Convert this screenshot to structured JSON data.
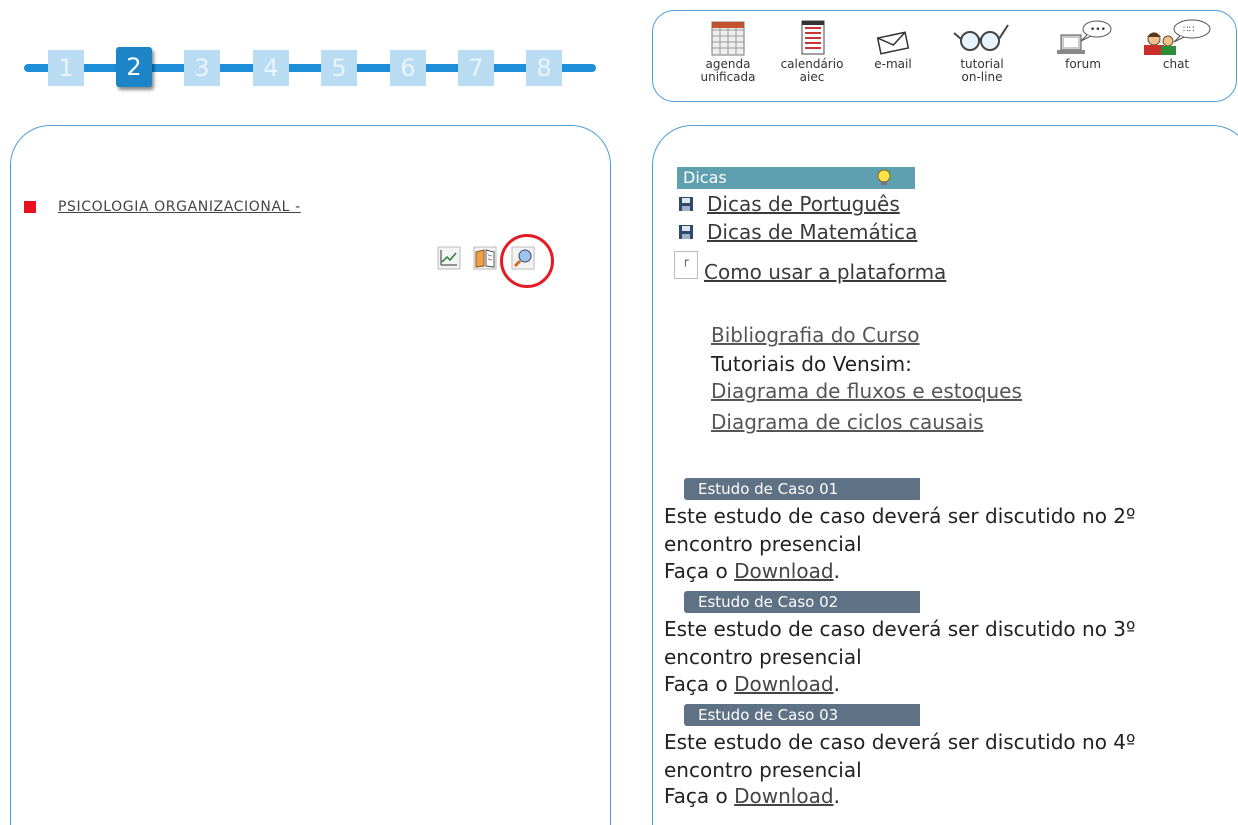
{
  "steps": {
    "items": [
      "1",
      "2",
      "3",
      "4",
      "5",
      "6",
      "7",
      "8"
    ],
    "active_index": 1
  },
  "tools": {
    "agenda": {
      "line1": "agenda",
      "line2": "unificada",
      "icon": "calendar-grid-icon"
    },
    "calendario": {
      "line1": "calendário",
      "line2": "aiec",
      "icon": "notepad-icon"
    },
    "email": {
      "line1": "e-mail",
      "icon": "envelope-icon"
    },
    "tutorial": {
      "line1": "tutorial",
      "line2": "on-line",
      "icon": "glasses-icon"
    },
    "forum": {
      "line1": "forum",
      "icon": "computer-speech-icon"
    },
    "chat": {
      "line1": "chat",
      "icon": "people-chat-icon"
    }
  },
  "left": {
    "course_label": "PSICOLOGIA ORGANIZACIONAL -",
    "course_icons": [
      "chart-icon",
      "book-icon",
      "search-icon"
    ]
  },
  "right": {
    "dicas_header": "Dicas",
    "dicas_links": [
      "Dicas de Português",
      "Dicas de Matemática"
    ],
    "checkbox_mark": "┌",
    "platform_link": "Como usar a plataforma",
    "bibliografia": "Bibliografia do Curso",
    "tutoriais_label": "Tutoriais do Vensim:",
    "vensim_links": [
      "Diagrama de fluxos e estoques",
      "Diagrama de ciclos causais"
    ],
    "casos": [
      {
        "header": "Estudo de Caso 01",
        "line1": "Este estudo de caso deverá ser discutido no 2º",
        "line2": "encontro presencial",
        "prefix": "Faça o ",
        "link": "Download",
        "suffix": "."
      },
      {
        "header": "Estudo de Caso 02",
        "line1": "Este estudo de caso deverá ser discutido no 3º",
        "line2": "encontro presencial",
        "prefix": "Faça o ",
        "link": "Download",
        "suffix": "."
      },
      {
        "header": "Estudo de Caso 03",
        "line1": "Este estudo de caso deverá ser discutido no 4º",
        "line2": "encontro presencial",
        "prefix": "Faça o ",
        "link": "Download",
        "suffix": "."
      }
    ]
  },
  "colors": {
    "accent_blue": "#1f8ed8",
    "step_inactive": "#b9dcf3",
    "dicas_header": "#5e9fb0",
    "caso_header": "#5f7185",
    "highlight_red": "#e21b24"
  }
}
